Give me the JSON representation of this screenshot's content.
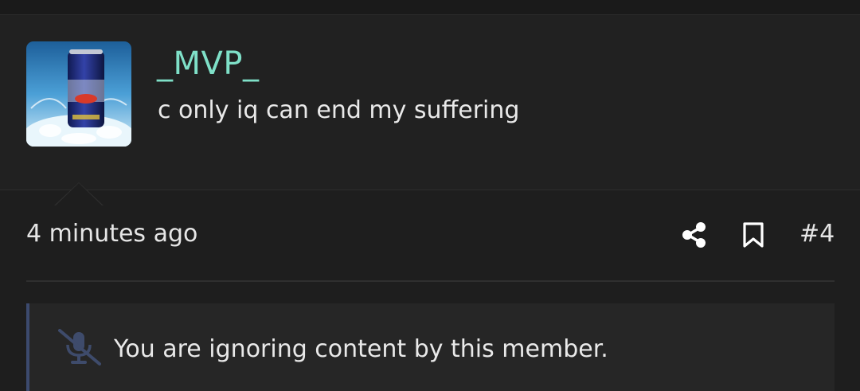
{
  "post": {
    "username": "_MVP_",
    "message": "c only iq can end my suffering",
    "timestamp": "4 minutes ago",
    "post_number": "#4",
    "avatar_icon": "red-bull-can-avatar"
  },
  "actions": {
    "share_icon": "share-icon",
    "bookmark_icon": "bookmark-icon"
  },
  "notice": {
    "icon": "microphone-slash-icon",
    "text": "You are ignoring content by this member."
  },
  "colors": {
    "background": "#1e1e1e",
    "header_background": "#212121",
    "username": "#7fe0c8",
    "text": "#e9e9e9",
    "notice_border": "#3c4a6e",
    "mute_icon": "#3e4b6b"
  }
}
